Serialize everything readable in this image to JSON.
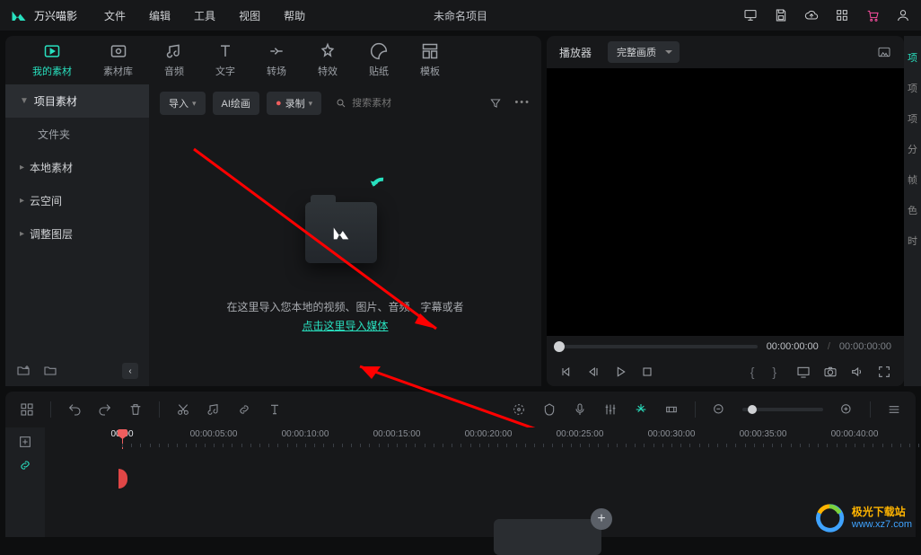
{
  "app_name": "万兴喵影",
  "menu": {
    "file": "文件",
    "edit": "编辑",
    "tool": "工具",
    "view": "视图",
    "help": "帮助"
  },
  "project_title": "未命名项目",
  "tabs": {
    "my_media": "我的素材",
    "stock": "素材库",
    "audio": "音频",
    "text": "文字",
    "transition": "转场",
    "effect": "特效",
    "sticker": "贴纸",
    "template": "模板"
  },
  "sidebar": {
    "project": "项目素材",
    "folder": "文件夹",
    "local": "本地素材",
    "cloud": "云空间",
    "adjust": "调整图层"
  },
  "toolbar": {
    "import": "导入",
    "ai_draw": "AI绘画",
    "record": "录制",
    "search_placeholder": "搜索素材"
  },
  "drop": {
    "text": "在这里导入您本地的视频、图片、音频、字幕或者",
    "link": "点击这里导入媒体"
  },
  "preview": {
    "player": "播放器",
    "quality": "完整画质",
    "time_current": "00:00:00:00",
    "time_total": "00:00:00:00"
  },
  "right_strip": {
    "top": "项",
    "l1": "项",
    "l2": "项",
    "l3": "分",
    "l4": "帧",
    "l5": "色",
    "l6": "时"
  },
  "ruler": [
    "00:00",
    "00:00:05:00",
    "00:00:10:00",
    "00:00:15:00",
    "00:00:20:00",
    "00:00:25:00",
    "00:00:30:00",
    "00:00:35:00",
    "00:00:40:00"
  ],
  "watermark": {
    "cn": "极光下载站",
    "url": "www.xz7.com"
  }
}
